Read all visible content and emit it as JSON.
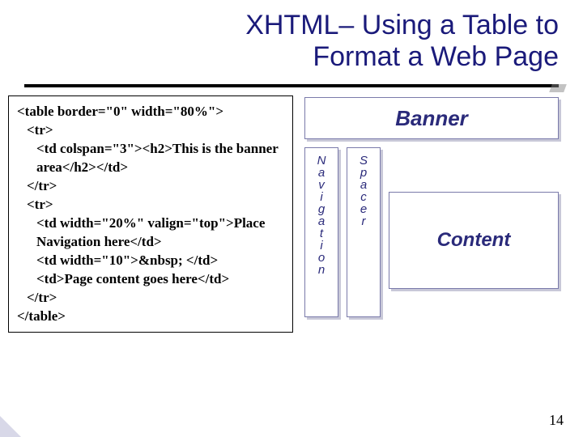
{
  "title_line1": "XHTML– Using a Table to",
  "title_line2": "Format a Web Page",
  "code": {
    "l1": "<table border=\"0\" width=\"80%\">",
    "l2": "<tr>",
    "l3": "<td colspan=\"3\"><h2>This is the banner area</h2></td>",
    "l4": "</tr>",
    "l5": "<tr>",
    "l6": "<td width=\"20%\" valign=\"top\">Place Navigation here</td>",
    "l7": "<td width=\"10\">&nbsp; </td>",
    "l8": "<td>Page content goes here</td>",
    "l9": "</tr>",
    "l10": "</table>"
  },
  "diagram": {
    "banner": "Banner",
    "navigation": "Navigation",
    "spacer": "Spacer",
    "content": "Content"
  },
  "page_number": "14"
}
